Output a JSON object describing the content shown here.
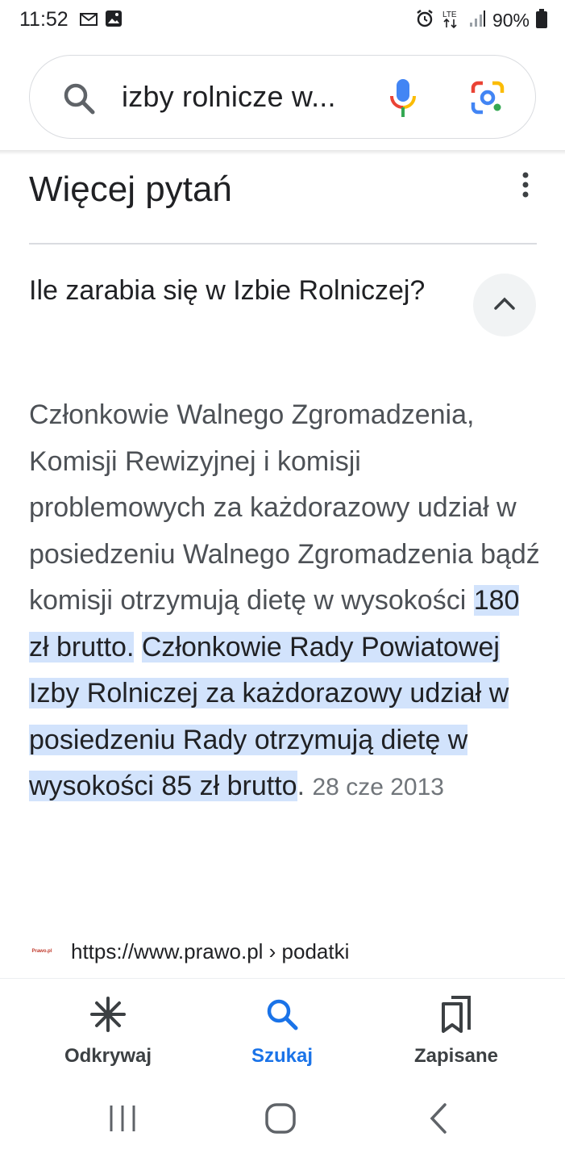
{
  "status_bar": {
    "time": "11:52",
    "battery": "90%",
    "network": "LTE"
  },
  "search": {
    "query": "izby rolnicze w..."
  },
  "section": {
    "title": "Więcej pytań"
  },
  "question": {
    "text": "Ile zarabia się w Izbie Rolniczej?"
  },
  "answer": {
    "plain": "Członkowie Walnego Zgromadzenia, Komisji Rewizyjnej i komisji problemowych za każdorazowy udział w posiedzeniu Walnego Zgromadzenia bądź komisji otrzymują dietę w wysokości",
    "highlight_1": "180 zł brutto.",
    "highlight_2": "Członkowie Rady Powiatowej Izby Rolniczej za każdorazowy udział w posiedzeniu Rady otrzymują dietę w wysokości 85 zł brutto",
    "end": ".",
    "date": "28 cze 2013"
  },
  "source": {
    "favicon_text": "Prawo.pl",
    "url": "https://www.prawo.pl › podatki"
  },
  "bottom_nav": {
    "items": [
      {
        "label": "Odkrywaj",
        "icon": "asterisk-icon"
      },
      {
        "label": "Szukaj",
        "icon": "search-icon"
      },
      {
        "label": "Zapisane",
        "icon": "bookmarks-icon"
      }
    ],
    "active_color": "#1a73e8"
  },
  "colors": {
    "highlight": "#d2e3fc",
    "text": "#202124",
    "secondary_text": "#4d5156"
  }
}
